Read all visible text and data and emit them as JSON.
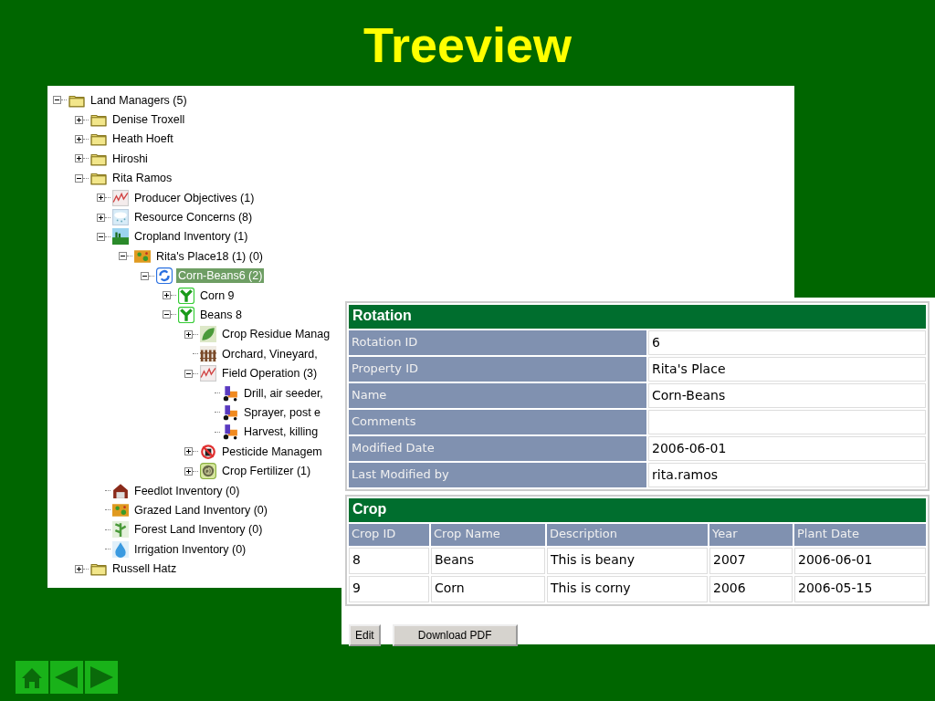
{
  "title": "Treeview",
  "tree": {
    "nodes": [
      {
        "label": "Land Managers (5)",
        "kind": "folder",
        "expanded": true,
        "selected": false,
        "children": [
          {
            "label": "Denise Troxell",
            "kind": "folder",
            "expanded": false,
            "selected": false
          },
          {
            "label": "Heath Hoeft",
            "kind": "folder",
            "expanded": false,
            "selected": false
          },
          {
            "label": "Hiroshi",
            "kind": "folder",
            "expanded": false,
            "selected": false
          },
          {
            "label": "Rita Ramos",
            "kind": "folder",
            "expanded": true,
            "selected": false,
            "children": [
              {
                "label": "Producer Objectives (1)",
                "kind": "chart",
                "expanded": false,
                "selected": false
              },
              {
                "label": "Resource Concerns (8)",
                "kind": "cloud",
                "expanded": false,
                "selected": false
              },
              {
                "label": "Cropland Inventory (1)",
                "kind": "cropland",
                "expanded": true,
                "selected": false,
                "children": [
                  {
                    "label": "Rita's Place18 (1) (0)",
                    "kind": "map",
                    "expanded": true,
                    "selected": false,
                    "children": [
                      {
                        "label": "Corn-Beans6 (2)",
                        "kind": "rotation",
                        "expanded": true,
                        "selected": true,
                        "children": [
                          {
                            "label": "Corn 9",
                            "kind": "sprout",
                            "expanded": false,
                            "selected": false
                          },
                          {
                            "label": "Beans 8",
                            "kind": "sprout",
                            "expanded": true,
                            "selected": false,
                            "children": [
                              {
                                "label": "Crop Residue Manag",
                                "kind": "leaf",
                                "expanded": false,
                                "selected": false
                              },
                              {
                                "label": "Orchard, Vineyard,",
                                "kind": "fence",
                                "selected": false
                              },
                              {
                                "label": "Field Operation (3)",
                                "kind": "chart",
                                "expanded": true,
                                "selected": false,
                                "children": [
                                  {
                                    "label": "Drill, air seeder,",
                                    "kind": "tractor",
                                    "selected": false
                                  },
                                  {
                                    "label": "Sprayer, post e",
                                    "kind": "tractor",
                                    "selected": false
                                  },
                                  {
                                    "label": "Harvest, killing",
                                    "kind": "tractor",
                                    "selected": false
                                  }
                                ]
                              },
                              {
                                "label": "Pesticide Managem",
                                "kind": "pesticide",
                                "expanded": false,
                                "selected": false
                              },
                              {
                                "label": "Crop Fertilizer (1)",
                                "kind": "fertilizer",
                                "expanded": false,
                                "selected": false
                              }
                            ]
                          }
                        ]
                      }
                    ]
                  }
                ]
              },
              {
                "label": "Feedlot Inventory (0)",
                "kind": "barn",
                "selected": false
              },
              {
                "label": "Grazed Land Inventory (0)",
                "kind": "map",
                "selected": false
              },
              {
                "label": "Forest Land Inventory (0)",
                "kind": "forest",
                "selected": false
              },
              {
                "label": "Irrigation Inventory (0)",
                "kind": "water",
                "selected": false
              }
            ]
          },
          {
            "label": "Russell Hatz",
            "kind": "folder",
            "expanded": false,
            "selected": false
          }
        ]
      }
    ]
  },
  "rotation": {
    "title": "Rotation",
    "fields": [
      {
        "label": "Rotation ID",
        "value": "6"
      },
      {
        "label": "Property ID",
        "value": "Rita's Place"
      },
      {
        "label": "Name",
        "value": "Corn-Beans"
      },
      {
        "label": "Comments"
      },
      {
        "label": "Modified Date",
        "value": "2006-06-01"
      },
      {
        "label": "Last Modified by",
        "value": "rita.ramos"
      }
    ]
  },
  "crop": {
    "title": "Crop",
    "columns": [
      "Crop ID",
      "Crop Name",
      "Description",
      "Year",
      "Plant Date"
    ],
    "rows": [
      [
        "8",
        "Beans",
        "This is beany",
        "2007",
        "2006-06-01"
      ],
      [
        "9",
        "Corn",
        "This is corny",
        "2006",
        "2006-05-15"
      ]
    ]
  },
  "buttons": [
    {
      "label": "Edit"
    },
    {
      "label": "Download PDF"
    }
  ]
}
